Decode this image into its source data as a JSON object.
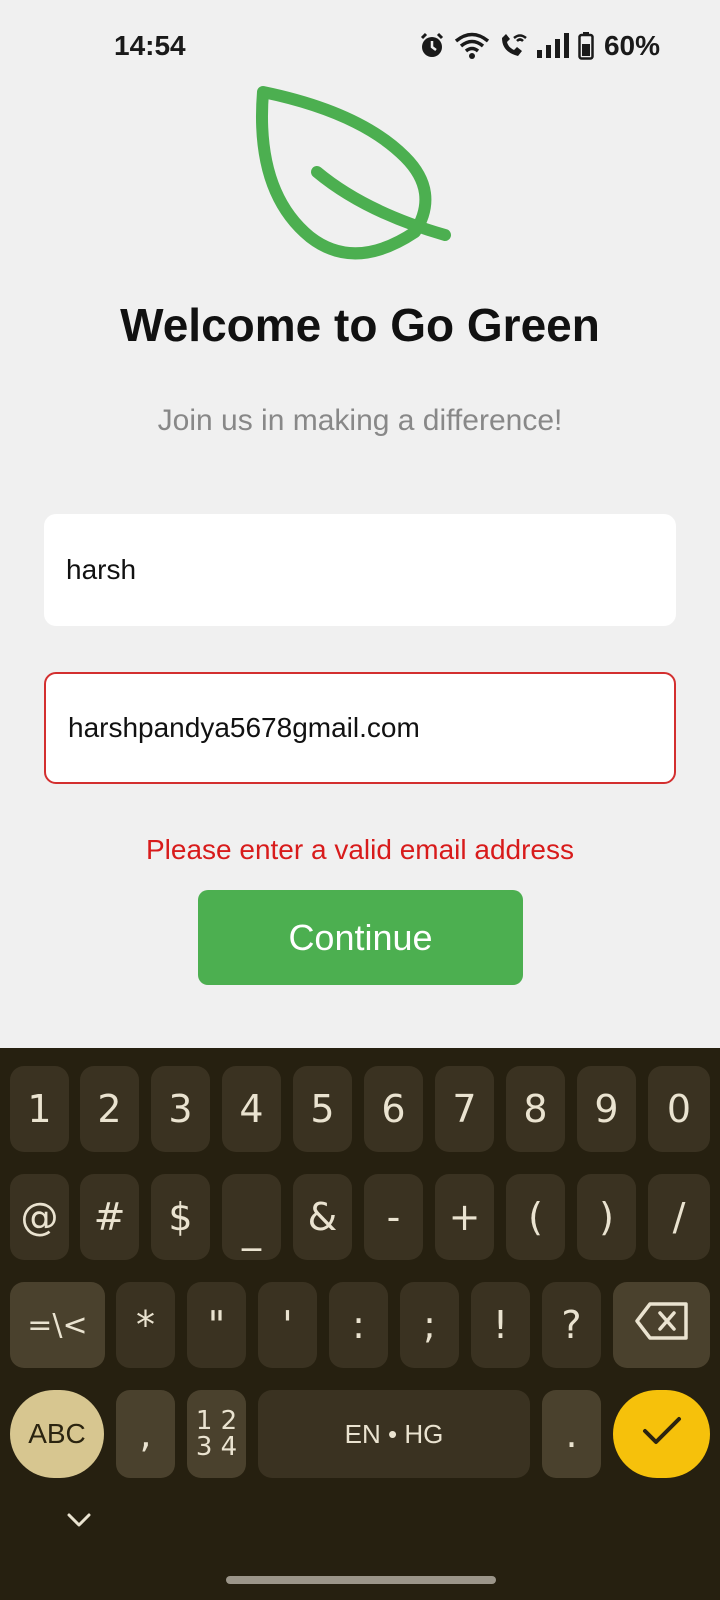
{
  "status_bar": {
    "time": "14:54",
    "battery": "60%",
    "icons": [
      "alarm-icon",
      "wifi-icon",
      "wifi-call-icon",
      "signal-icon",
      "battery-icon"
    ]
  },
  "app": {
    "logo": "leaf-icon",
    "title": "Welcome to Go Green",
    "subtitle": "Join us in making a difference!",
    "name_value": "harsh",
    "email_value": "harshpandya5678gmail.com",
    "error": "Please enter a valid email address",
    "continue_label": "Continue",
    "colors": {
      "accent": "#4caf50",
      "error": "#d32f2f",
      "background": "#f0f0f0"
    }
  },
  "keyboard": {
    "row1": [
      "1",
      "2",
      "3",
      "4",
      "5",
      "6",
      "7",
      "8",
      "9",
      "0"
    ],
    "row2": [
      "@",
      "#",
      "$",
      "_",
      "&",
      "-",
      "+",
      "(",
      ")",
      "/"
    ],
    "row3": [
      "=\\<",
      "*",
      "\"",
      "'",
      ":",
      ";",
      "!",
      "?"
    ],
    "abc": "ABC",
    "comma": ",",
    "num_a": "1 2",
    "num_b": "3 4",
    "space": "EN • HG",
    "period": ".",
    "icons": [
      "backspace-icon",
      "checkmark-icon",
      "chevron-down-icon"
    ]
  }
}
